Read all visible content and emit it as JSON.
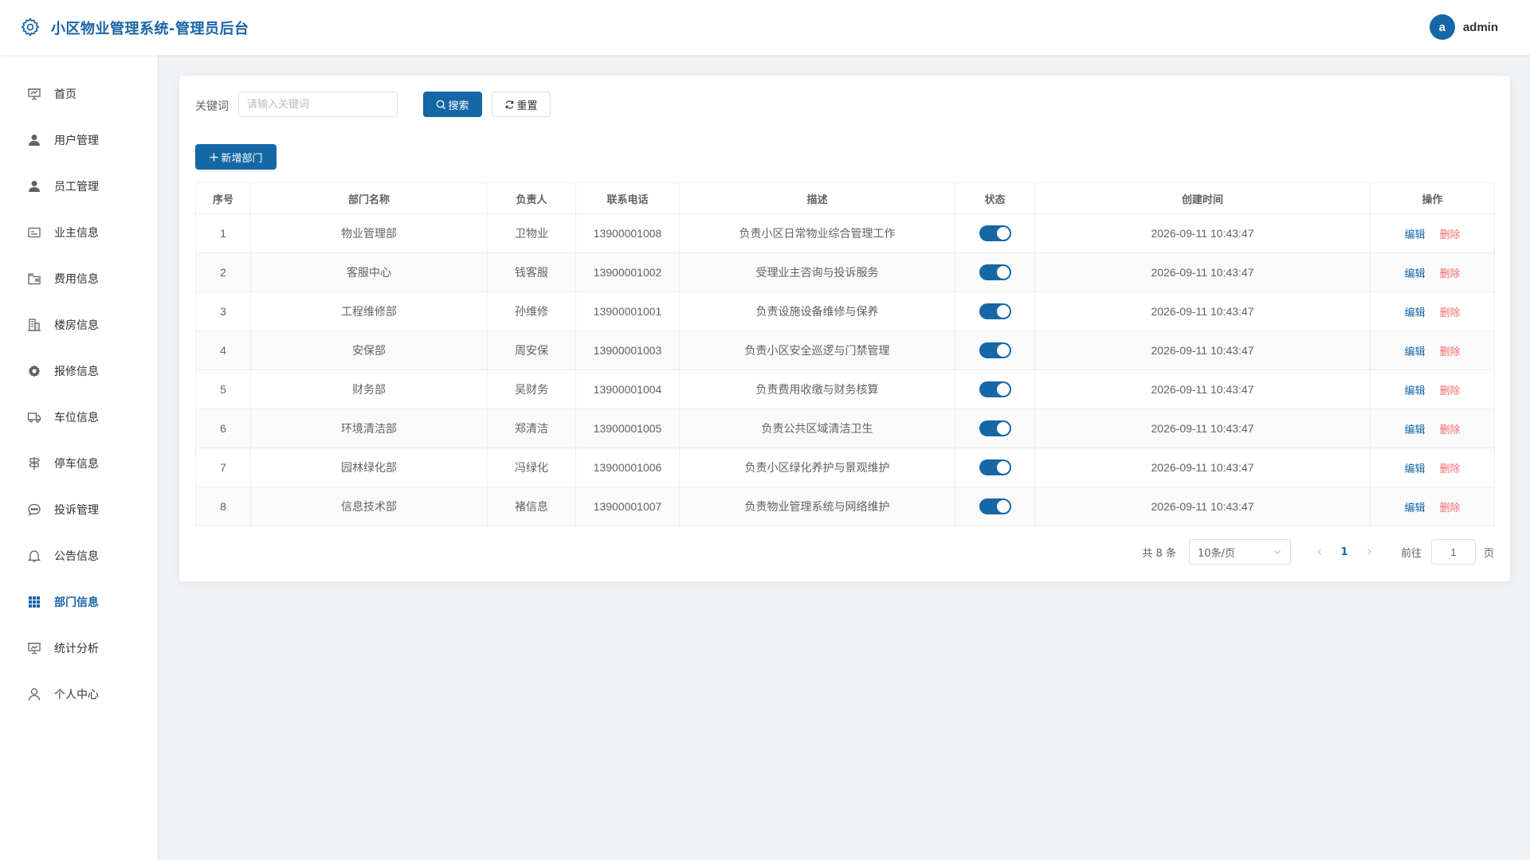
{
  "header": {
    "title": "小区物业管理系统-管理员后台",
    "avatar_letter": "a",
    "username": "admin",
    "logo_icon": "gear-icon"
  },
  "sidebar": {
    "items": [
      {
        "label": "首页",
        "icon": "presentation-icon",
        "active": false
      },
      {
        "label": "用户管理",
        "icon": "user-filled-icon",
        "active": false
      },
      {
        "label": "员工管理",
        "icon": "user-filled-icon",
        "active": false
      },
      {
        "label": "业主信息",
        "icon": "id-card-icon",
        "active": false
      },
      {
        "label": "费用信息",
        "icon": "wallet-icon",
        "active": false
      },
      {
        "label": "楼房信息",
        "icon": "building-icon",
        "active": false
      },
      {
        "label": "报修信息",
        "icon": "cog-icon",
        "active": false
      },
      {
        "label": "车位信息",
        "icon": "truck-icon",
        "active": false
      },
      {
        "label": "停车信息",
        "icon": "signpost-icon",
        "active": false
      },
      {
        "label": "投诉管理",
        "icon": "chat-icon",
        "active": false
      },
      {
        "label": "公告信息",
        "icon": "bell-icon",
        "active": false
      },
      {
        "label": "部门信息",
        "icon": "grid-icon",
        "active": true
      },
      {
        "label": "统计分析",
        "icon": "chart-board-icon",
        "active": false
      },
      {
        "label": "个人中心",
        "icon": "user-outline-icon",
        "active": false
      }
    ]
  },
  "search": {
    "label": "关键词",
    "placeholder": "请输入关键词",
    "value": "",
    "search_button": "搜索",
    "reset_button": "重置"
  },
  "toolbar": {
    "add_button": "新增部门"
  },
  "table": {
    "columns": [
      "序号",
      "部门名称",
      "负责人",
      "联系电话",
      "描述",
      "状态",
      "创建时间",
      "操作"
    ],
    "rows": [
      {
        "index": "1",
        "name": "物业管理部",
        "manager": "卫物业",
        "phone": "13900001008",
        "desc": "负责小区日常物业综合管理工作",
        "status": true,
        "created": "2026-09-11 10:43:47"
      },
      {
        "index": "2",
        "name": "客服中心",
        "manager": "钱客服",
        "phone": "13900001002",
        "desc": "受理业主咨询与投诉服务",
        "status": true,
        "created": "2026-09-11 10:43:47"
      },
      {
        "index": "3",
        "name": "工程维修部",
        "manager": "孙维修",
        "phone": "13900001001",
        "desc": "负责设施设备维修与保养",
        "status": true,
        "created": "2026-09-11 10:43:47"
      },
      {
        "index": "4",
        "name": "安保部",
        "manager": "周安保",
        "phone": "13900001003",
        "desc": "负责小区安全巡逻与门禁管理",
        "status": true,
        "created": "2026-09-11 10:43:47"
      },
      {
        "index": "5",
        "name": "财务部",
        "manager": "吴财务",
        "phone": "13900001004",
        "desc": "负责费用收缴与财务核算",
        "status": true,
        "created": "2026-09-11 10:43:47"
      },
      {
        "index": "6",
        "name": "环境清洁部",
        "manager": "郑清洁",
        "phone": "13900001005",
        "desc": "负责公共区域清洁卫生",
        "status": true,
        "created": "2026-09-11 10:43:47"
      },
      {
        "index": "7",
        "name": "园林绿化部",
        "manager": "冯绿化",
        "phone": "13900001006",
        "desc": "负责小区绿化养护与景观维护",
        "status": true,
        "created": "2026-09-11 10:43:47"
      },
      {
        "index": "8",
        "name": "信息技术部",
        "manager": "褚信息",
        "phone": "13900001007",
        "desc": "负责物业管理系统与网络维护",
        "status": true,
        "created": "2026-09-11 10:43:47"
      }
    ],
    "edit_label": "编辑",
    "delete_label": "删除"
  },
  "pagination": {
    "total_text": "共 8 条",
    "page_size": "10条/页",
    "current_page": "1",
    "goto_label": "前往",
    "goto_value": "1",
    "goto_unit": "页"
  },
  "colors": {
    "primary": "#1567a5",
    "danger": "#f56c6c",
    "title": "#1a64a6"
  }
}
